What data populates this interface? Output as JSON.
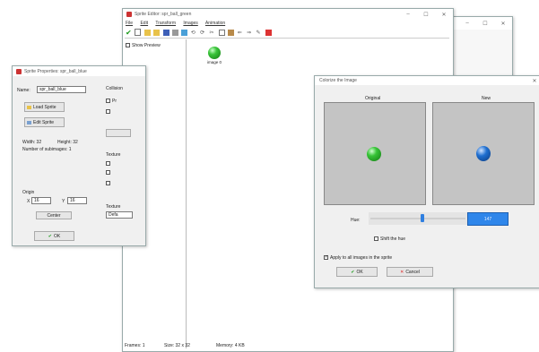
{
  "back_window": {
    "min": "–",
    "max": "☐",
    "close": "✕"
  },
  "sprite_editor": {
    "title": "Sprite Editor: spr_ball_green",
    "menu": [
      "File",
      "Edit",
      "Transform",
      "Images",
      "Animation"
    ],
    "show_preview_label": "Show Preview",
    "image_label": "image 0",
    "status": {
      "frames": "Frames: 1",
      "size": "Size: 32 x 32",
      "memory": "Memory: 4 KB"
    },
    "colors": {
      "ball": "#2fbf2f"
    }
  },
  "sprite_properties": {
    "title": "Sprite Properties: spr_ball_blue",
    "name_label": "Name:",
    "name_value": "spr_ball_blue",
    "load_button": "Load Sprite",
    "edit_button": "Edit Sprite",
    "width": "Width: 32",
    "height": "Height: 32",
    "subimages": "Number of subimages: 1",
    "origin_label": "Origin",
    "x_label": "X",
    "x_value": "16",
    "y_label": "Y",
    "y_value": "16",
    "center_button": "Center",
    "ok_button": "OK",
    "col_label": "Collision",
    "texture_label": "Texture",
    "col_letters": "Pr",
    "defa": "Defa"
  },
  "colorize_dialog": {
    "title": "Colorize the Image",
    "original_label": "Original",
    "new_label": "New",
    "hue_label": "Hue:",
    "hue_value": "147",
    "shift_hue_label": "Shift the hue",
    "apply_all_label": "Apply to all images in the sprite",
    "ok_button": "OK",
    "cancel_button": "Cancel",
    "colors": {
      "original_ball": "#37c437",
      "new_ball": "#1f6fd0",
      "hue_box": "#2f86ea",
      "preview_bg": "#c4c4c4"
    }
  }
}
